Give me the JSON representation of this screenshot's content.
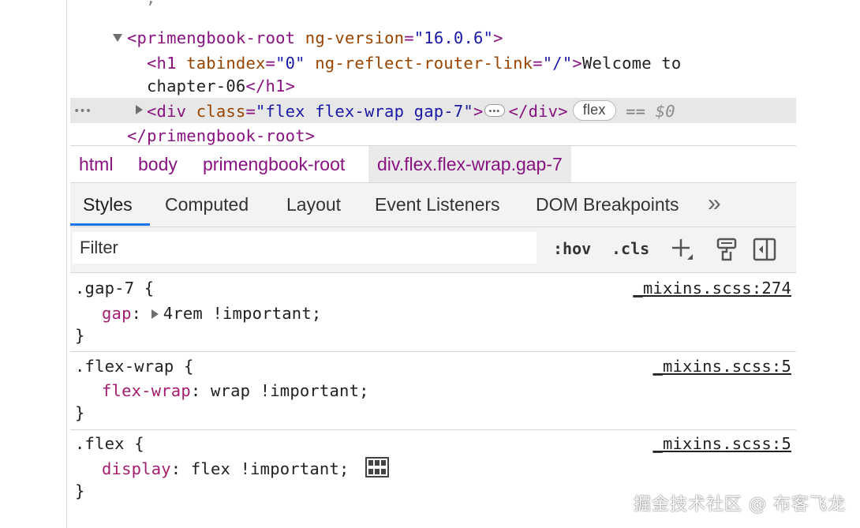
{
  "elements_tree": {
    "root_open_tag": {
      "tag": "primengbook-root",
      "attr_name": "ng-version",
      "attr_value": "\"16.0.6\""
    },
    "h1": {
      "open_tag": "h1",
      "attr1_name": "tabindex",
      "attr1_value": "\"0\"",
      "attr2_name": "ng-reflect-router-link",
      "attr2_value": "\"/\"",
      "text_line1": "Welcome to",
      "text_line2": "chapter-06",
      "close_tag": "</h1>"
    },
    "selected_div": {
      "row_dots": "•••",
      "tag": "div",
      "attr_name": "class",
      "attr_value": "\"flex flex-wrap gap-7\"",
      "close_tag": "</div>",
      "badge": "flex",
      "equals": "==",
      "dollar": "$0"
    },
    "root_close_tag": "</primengbook-root>"
  },
  "breadcrumb": {
    "items": [
      {
        "label": "html"
      },
      {
        "label": "body"
      },
      {
        "label": "primengbook-root"
      },
      {
        "label": "div.flex.flex-wrap.gap-7"
      }
    ]
  },
  "tabs": {
    "items": [
      {
        "label": "Styles"
      },
      {
        "label": "Computed"
      },
      {
        "label": "Layout"
      },
      {
        "label": "Event Listeners"
      },
      {
        "label": "DOM Breakpoints"
      }
    ],
    "more": "»",
    "active": "Styles"
  },
  "filter": {
    "placeholder": "Filter",
    "hov": ":hov",
    "cls": ".cls"
  },
  "rules": [
    {
      "selector": ".gap-7 {",
      "source": "_mixins.scss:274",
      "property": "gap",
      "value": "4rem !important;",
      "close": "}"
    },
    {
      "selector": ".flex-wrap {",
      "source": "_mixins.scss:5",
      "property": "flex-wrap",
      "value": "wrap !important;",
      "close": "}"
    },
    {
      "selector": ".flex {",
      "source": "_mixins.scss:5",
      "property": "display",
      "value": "flex !important;",
      "close": "}"
    }
  ],
  "watermark": "掘金技术社区 @ 布客飞龙",
  "colors": {
    "tag": "#881280",
    "attribute": "#994500",
    "attribute_value": "#1a1aa6",
    "property": "#a31e6e",
    "active_tab_underline": "#1a73e8",
    "selected_row": "#e7e7e7"
  },
  "icons": [
    "expand-triangle-icon",
    "collapse-triangle-icon",
    "new-rule-icon",
    "paint-brush-icon",
    "sidebar-toggle-icon",
    "flexbox-editor-icon"
  ]
}
